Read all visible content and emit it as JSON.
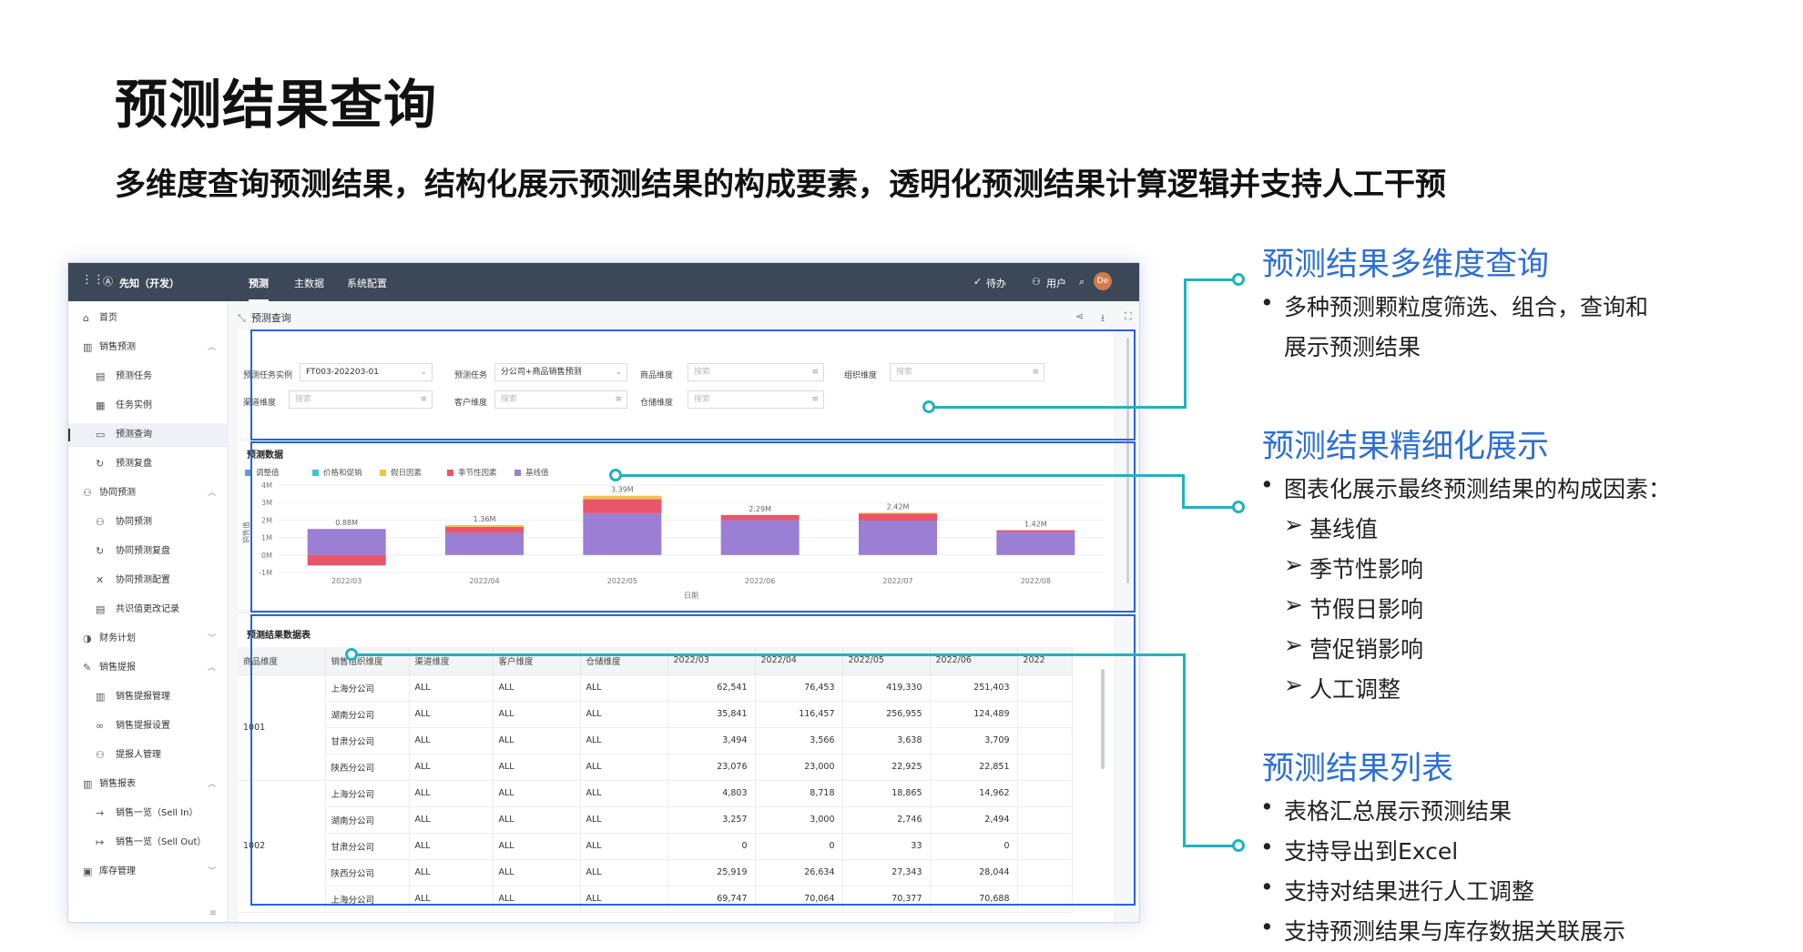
{
  "slide": {
    "title": "预测结果查询",
    "subtitle": "多维度查询预测结果，结构化展示预测结果的构成要素，透明化预测结果计算逻辑并支持人工干预"
  },
  "app": {
    "logo": "先知（开发）",
    "tabs": [
      "预测",
      "主数据",
      "系统配置"
    ],
    "todo": "待办",
    "user": "用户",
    "avatar": "De",
    "breadcrumb": "预测查询"
  },
  "sidebar": {
    "items": [
      {
        "label": "首页",
        "icon": "home-icon"
      },
      {
        "label": "销售预测",
        "icon": "chart-icon",
        "expanded": true
      },
      {
        "label": "预测任务",
        "icon": "task-icon"
      },
      {
        "label": "任务实例",
        "icon": "instance-icon"
      },
      {
        "label": "预测查询",
        "icon": "query-icon",
        "active": true
      },
      {
        "label": "预测复盘",
        "icon": "review-icon"
      },
      {
        "label": "协同预测",
        "icon": "team-icon",
        "expanded": true
      },
      {
        "label": "协同预测",
        "icon": "collab-icon"
      },
      {
        "label": "协同预测复盘",
        "icon": "collab-review-icon"
      },
      {
        "label": "协同预测配置",
        "icon": "wrench-icon"
      },
      {
        "label": "共识值更改记录",
        "icon": "record-icon"
      },
      {
        "label": "财务计划",
        "icon": "finance-icon"
      },
      {
        "label": "销售提报",
        "icon": "edit-icon",
        "expanded": true
      },
      {
        "label": "销售提报管理",
        "icon": "bar-icon"
      },
      {
        "label": "销售提报设置",
        "icon": "link-icon"
      },
      {
        "label": "提报人管理",
        "icon": "people-icon"
      },
      {
        "label": "销售报表",
        "icon": "report-icon",
        "expanded": true
      },
      {
        "label": "销售一览（Sell In）",
        "icon": "sell-in-icon"
      },
      {
        "label": "销售一览（Sell Out）",
        "icon": "sell-out-icon"
      },
      {
        "label": "库存管理",
        "icon": "stock-icon"
      }
    ]
  },
  "filters": {
    "task_instance_label": "预测任务实例",
    "task_instance_value": "FT003-202203-01",
    "task_label": "预测任务",
    "task_value": "分公司+商品销售预测",
    "product_label": "商品维度",
    "org_label": "组织维度",
    "channel_label": "渠道维度",
    "customer_label": "客户维度",
    "warehouse_label": "仓储维度",
    "search_placeholder": "搜索"
  },
  "chart_section": {
    "title": "预测数据",
    "xlabel": "日期",
    "ylabel": "销售值"
  },
  "chart_data": {
    "type": "bar",
    "categories": [
      "2022/03",
      "2022/04",
      "2022/05",
      "2022/06",
      "2022/07",
      "2022/08"
    ],
    "series": [
      {
        "name": "调整值",
        "color": "#5a9fd6",
        "values": [
          0,
          0,
          0,
          0,
          0,
          0
        ]
      },
      {
        "name": "价格和促销",
        "color": "#3ec5c8",
        "values": [
          0,
          0,
          0,
          0,
          0,
          0
        ]
      },
      {
        "name": "假日因素",
        "color": "#f2c14e",
        "values": [
          0,
          0.1,
          0.2,
          0,
          0.05,
          0
        ]
      },
      {
        "name": "季节性因素",
        "color": "#e9566b",
        "values": [
          -0.6,
          0.35,
          0.8,
          0.3,
          0.4,
          0.1
        ]
      },
      {
        "name": "基线值",
        "color": "#9b7fd4",
        "values": [
          1.49,
          1.26,
          2.39,
          1.99,
          1.97,
          1.32
        ]
      }
    ],
    "data_labels": [
      "0.88M",
      "1.36M",
      "3.39M",
      "2.29M",
      "2.42M",
      "1.42M"
    ],
    "yticks": [
      "4M",
      "3M",
      "2M",
      "1M",
      "0M",
      "-1M"
    ],
    "ylim": [
      -1,
      4
    ],
    "xlabel": "日期",
    "ylabel": "销售值"
  },
  "table_section": {
    "title": "预测结果数据表",
    "columns": [
      "商品维度",
      "销售组织维度",
      "渠道维度",
      "客户维度",
      "仓储维度",
      "2022/03",
      "2022/04",
      "2022/05",
      "2022/06",
      "2022"
    ],
    "groups": [
      {
        "product": "1001",
        "rows": [
          [
            "上海分公司",
            "ALL",
            "ALL",
            "ALL",
            "62,541",
            "76,453",
            "419,330",
            "251,403"
          ],
          [
            "湖南分公司",
            "ALL",
            "ALL",
            "ALL",
            "35,841",
            "116,457",
            "256,955",
            "124,489"
          ],
          [
            "甘肃分公司",
            "ALL",
            "ALL",
            "ALL",
            "3,494",
            "3,566",
            "3,638",
            "3,709"
          ],
          [
            "陕西分公司",
            "ALL",
            "ALL",
            "ALL",
            "23,076",
            "23,000",
            "22,925",
            "22,851"
          ]
        ]
      },
      {
        "product": "1002",
        "rows": [
          [
            "上海分公司",
            "ALL",
            "ALL",
            "ALL",
            "4,803",
            "8,718",
            "18,865",
            "14,962"
          ],
          [
            "湖南分公司",
            "ALL",
            "ALL",
            "ALL",
            "3,257",
            "3,000",
            "2,746",
            "2,494"
          ],
          [
            "甘肃分公司",
            "ALL",
            "ALL",
            "ALL",
            "0",
            "0",
            "33",
            "0"
          ],
          [
            "陕西分公司",
            "ALL",
            "ALL",
            "ALL",
            "25,919",
            "26,634",
            "27,343",
            "28,044"
          ],
          [
            "上海分公司",
            "ALL",
            "ALL",
            "ALL",
            "69,747",
            "70,064",
            "70,377",
            "70,688"
          ]
        ]
      }
    ]
  },
  "callouts": [
    {
      "heading": "预测结果多维度查询",
      "bullets": [
        "多种预测颗粒度筛选、组合，查询和",
        "展示预测结果"
      ]
    },
    {
      "heading": "预测结果精细化展示",
      "bullets": [
        "图表化展示最终预测结果的构成因素："
      ],
      "sub_bullets": [
        "基线值",
        "季节性影响",
        "节假日影响",
        "营促销影响",
        "人工调整"
      ]
    },
    {
      "heading": "预测结果列表",
      "bullets": [
        "表格汇总展示预测结果",
        "支持导出到Excel",
        "支持对结果进行人工调整",
        "支持预测结果与库存数据关联展示"
      ]
    }
  ],
  "colors": {
    "accent": "#2f6fd3",
    "connector": "#1fb3c0",
    "topbar": "#3c4757",
    "highlight": "#2b63d8"
  }
}
